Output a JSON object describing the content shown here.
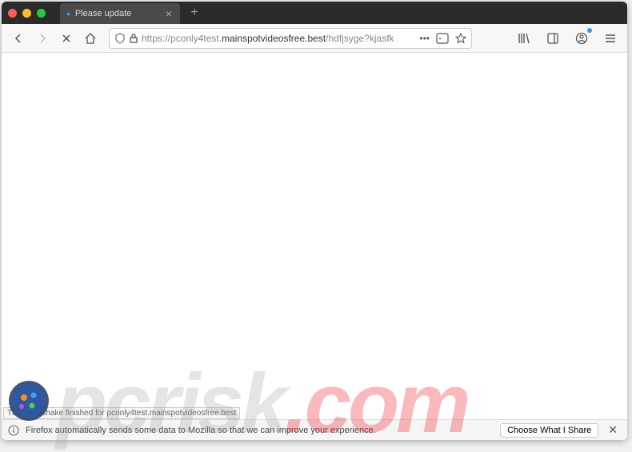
{
  "window": {
    "traffic": {
      "close": "close",
      "min": "minimize",
      "max": "maximize"
    }
  },
  "tabs": {
    "active": {
      "title": "Please update",
      "indicator": "•"
    },
    "new_tab": "+"
  },
  "navigation": {
    "back": "←",
    "forward": "→",
    "stop": "✕",
    "home": "⌂"
  },
  "url": {
    "protocol": "https://",
    "subdomain": "pconly4test.",
    "domain": "mainspotvideosfree.best",
    "path": "/hdfjsyge?kjasfk",
    "actions": {
      "more": "•••",
      "reader": "▭",
      "bookmark": "☆"
    }
  },
  "toolbar_right": {
    "library": "library",
    "sidebar": "sidebar",
    "profile": "profile",
    "menu": "menu"
  },
  "status": {
    "text": "TLS handshake finished for pconly4test.mainspotvideosfree.best"
  },
  "notice": {
    "icon": "info",
    "text": "Firefox automatically sends some data to Mozilla so that we can improve your experience.",
    "button": "Choose What I Share",
    "close": "✕"
  },
  "watermark": {
    "pc": "pc",
    "risk": "risk",
    "dot": ".",
    "com": "com"
  }
}
